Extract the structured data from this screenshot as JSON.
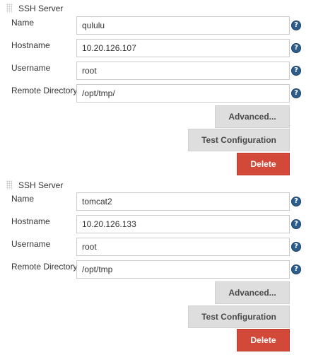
{
  "labels": {
    "section_title": "SSH Server",
    "name": "Name",
    "hostname": "Hostname",
    "username": "Username",
    "remote_directory": "Remote Directory",
    "help_glyph": "?",
    "advanced_button": "Advanced...",
    "test_button": "Test Configuration",
    "delete_button": "Delete"
  },
  "servers": [
    {
      "name": "qululu",
      "hostname": "10.20.126.107",
      "username": "root",
      "remote_directory": "/opt/tmp/"
    },
    {
      "name": "tomcat2",
      "hostname": "10.20.126.133",
      "username": "root",
      "remote_directory": "/opt/tmp"
    }
  ],
  "colors": {
    "delete_button_bg": "#d24939",
    "grey_button_bg": "#dedede",
    "help_icon_bg": "#2c5d8f"
  }
}
